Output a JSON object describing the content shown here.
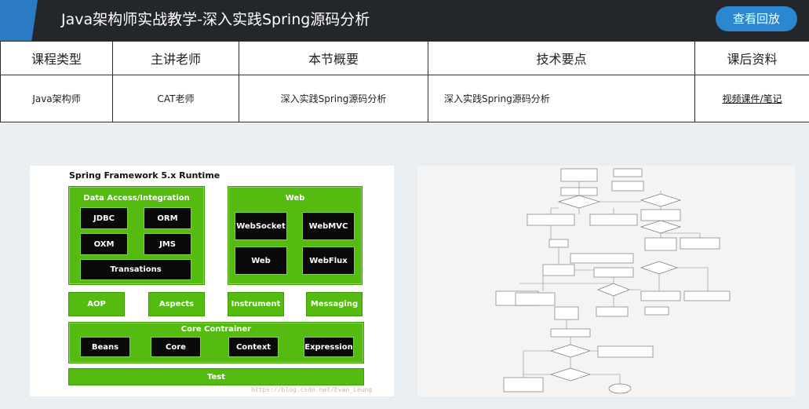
{
  "header": {
    "title": "Java架构师实战教学-深入实践Spring源码分析",
    "replay_button": "查看回放",
    "accent_color": "#2a7bc4",
    "bg_color": "#23262b"
  },
  "info_table": {
    "headers": [
      "课程类型",
      "主讲老师",
      "本节概要",
      "技术要点",
      "课后资料"
    ],
    "row": {
      "course_type": "Java架构师",
      "teacher": "CAT老师",
      "summary": "深入实践Spring源码分析",
      "key_points": "深入实践Spring源码分析",
      "materials_link": "视频课件/笔记"
    }
  },
  "spring_diagram": {
    "title": "Spring Framework 5.x Runtime",
    "data_access": {
      "label": "Data Access/Integration",
      "items": [
        "JDBC",
        "ORM",
        "OXM",
        "JMS",
        "Transations"
      ]
    },
    "web": {
      "label": "Web",
      "items": [
        "WebSocket",
        "WebMVC",
        "Web",
        "WebFlux"
      ]
    },
    "middle": [
      "AOP",
      "Aspects",
      "Instrument",
      "Messaging"
    ],
    "core": {
      "label": "Core Contrainer",
      "items": [
        "Beans",
        "Core",
        "Context",
        "Expression"
      ]
    },
    "test": "Test",
    "watermark": "https://blog.csdn.net/Evan_Leung",
    "green": "#55bb11"
  }
}
